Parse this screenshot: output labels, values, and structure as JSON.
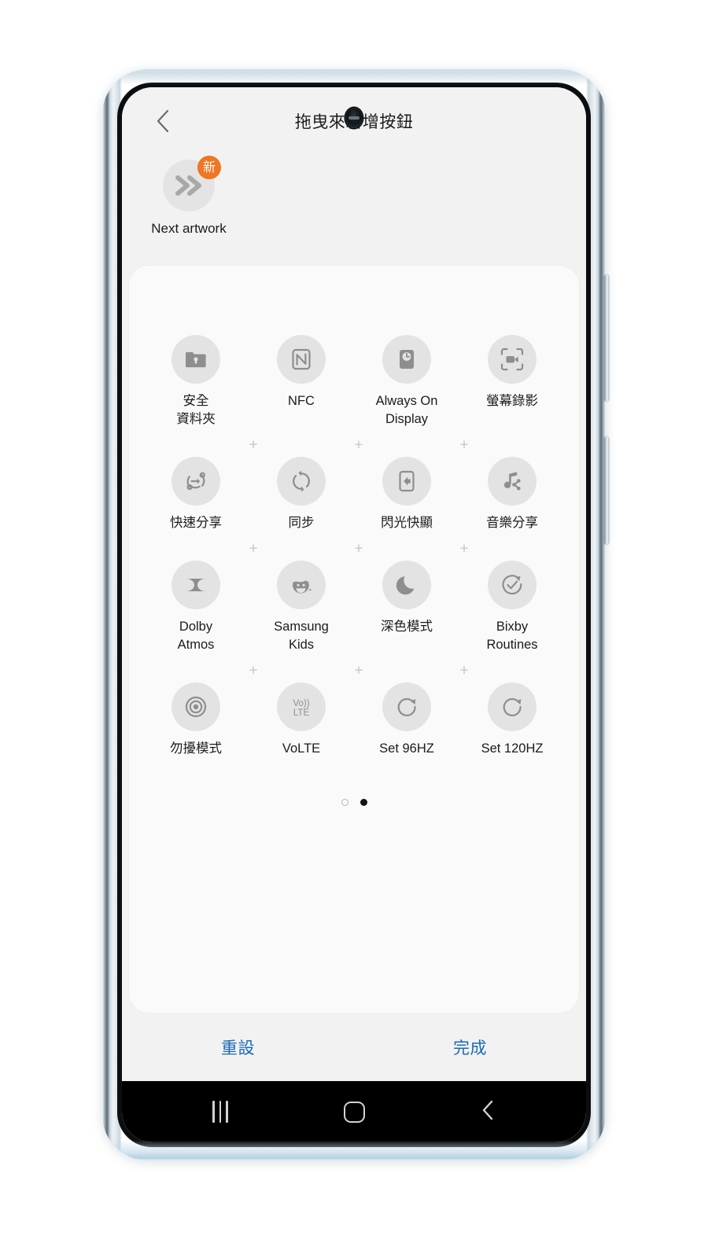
{
  "app": {
    "title": "拖曳來新增按鈕",
    "back_icon": "chevron-left-icon"
  },
  "preview": {
    "label": "Next artwork",
    "badge": "新",
    "icon": "double-chevron-right-icon",
    "badge_color": "#ef7622"
  },
  "grid": {
    "rows": [
      [
        {
          "label": "安全\n資料夾",
          "icon": "secure-folder-icon"
        },
        {
          "label": "NFC",
          "icon": "nfc-icon"
        },
        {
          "label": "Always On\nDisplay",
          "icon": "always-on-display-icon"
        },
        {
          "label": "螢幕錄影",
          "icon": "screen-recorder-icon"
        }
      ],
      [
        {
          "label": "快速分享",
          "icon": "quick-share-icon"
        },
        {
          "label": "同步",
          "icon": "sync-icon"
        },
        {
          "label": "閃光快顯",
          "icon": "flash-notification-icon"
        },
        {
          "label": "音樂分享",
          "icon": "music-share-icon"
        }
      ],
      [
        {
          "label": "Dolby\nAtmos",
          "icon": "dolby-atmos-icon"
        },
        {
          "label": "Samsung\nKids",
          "icon": "samsung-kids-icon"
        },
        {
          "label": "深色模式",
          "icon": "dark-mode-moon-icon"
        },
        {
          "label": "Bixby\nRoutines",
          "icon": "bixby-routines-icon"
        }
      ],
      [
        {
          "label": "勿擾模式",
          "icon": "do-not-disturb-icon"
        },
        {
          "label": "VoLTE",
          "icon": "volte-icon"
        },
        {
          "label": "Set 96HZ",
          "icon": "refresh-rate-icon"
        },
        {
          "label": "Set 120HZ",
          "icon": "refresh-rate-icon"
        }
      ]
    ],
    "separator": "+"
  },
  "pagination": {
    "pages": 2,
    "active_index": 1
  },
  "actions": {
    "reset_label": "重設",
    "done_label": "完成",
    "accent_color": "#1a6bb5"
  },
  "navbar": {
    "recents_icon": "recents-icon",
    "home_icon": "home-icon",
    "back_icon": "nav-back-icon"
  }
}
